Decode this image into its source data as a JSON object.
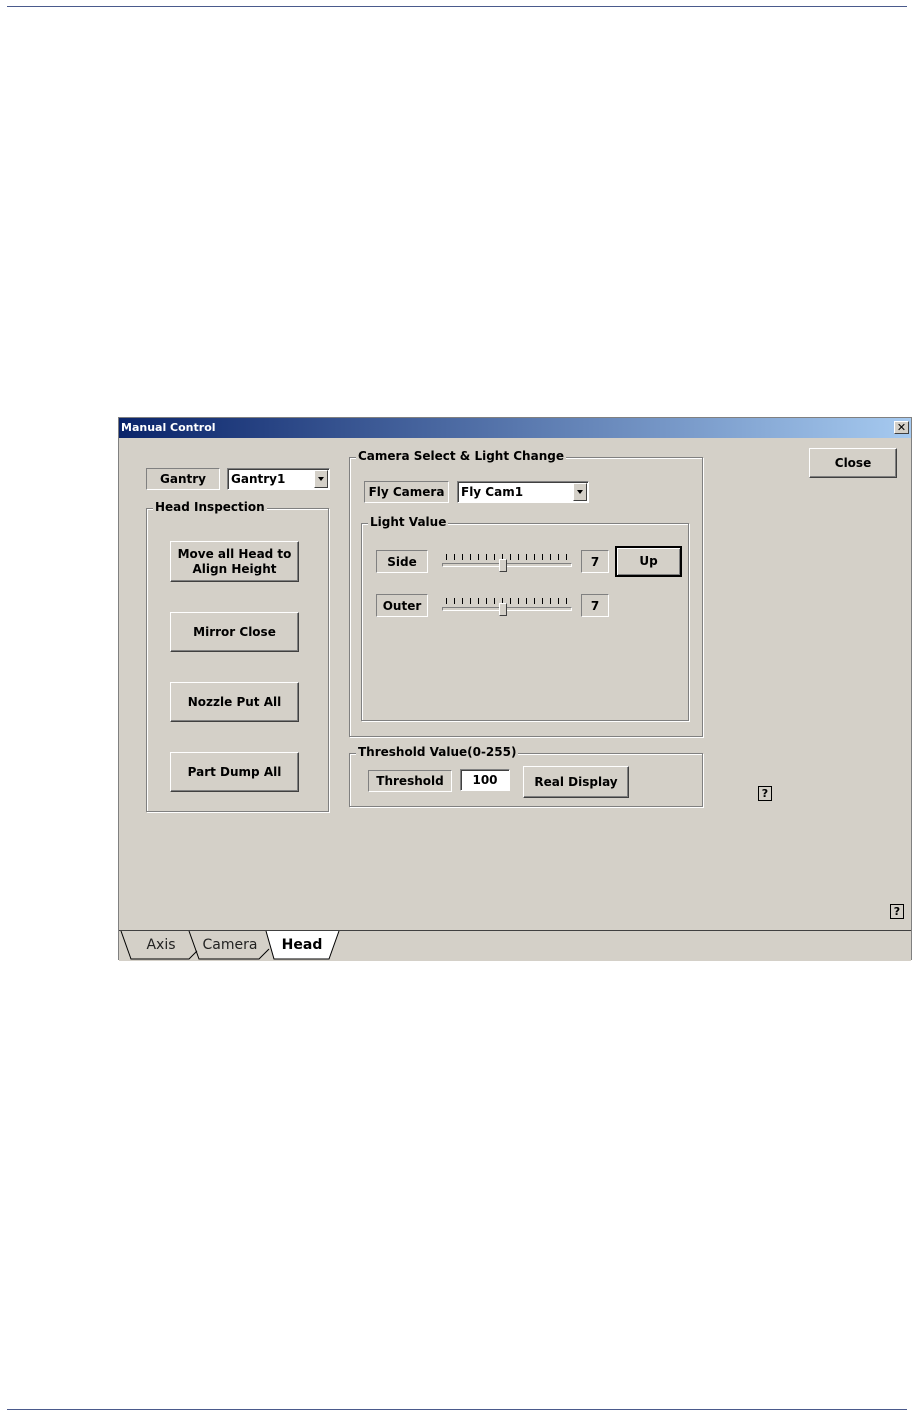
{
  "window": {
    "title": "Manual Control",
    "close_glyph": "✕"
  },
  "close_button": "Close",
  "gantry": {
    "label": "Gantry",
    "value": "Gantry1"
  },
  "head_inspection": {
    "title": "Head Inspection",
    "buttons": [
      {
        "label_line1": "Move all Head to",
        "label_line2": "Align Height"
      },
      {
        "label": "Mirror Close"
      },
      {
        "label": "Nozzle Put All"
      },
      {
        "label": "Part Dump All"
      }
    ]
  },
  "camera": {
    "title": "Camera Select & Light Change",
    "label": "Fly Camera",
    "value": "Fly Cam1",
    "light_value": {
      "title": "Light Value",
      "side": {
        "label": "Side",
        "value": "7",
        "level_fraction": 0.47
      },
      "outer": {
        "label": "Outer",
        "value": "7",
        "level_fraction": 0.47
      },
      "up_button": "Up"
    }
  },
  "threshold": {
    "title": "Threshold Value(0-255)",
    "label": "Threshold",
    "value": "100",
    "real_display_button": "Real Display"
  },
  "help_glyph": "?",
  "tabs": [
    {
      "label": "Axis",
      "active": false
    },
    {
      "label": "Camera",
      "active": false
    },
    {
      "label": "Head",
      "active": true
    }
  ]
}
